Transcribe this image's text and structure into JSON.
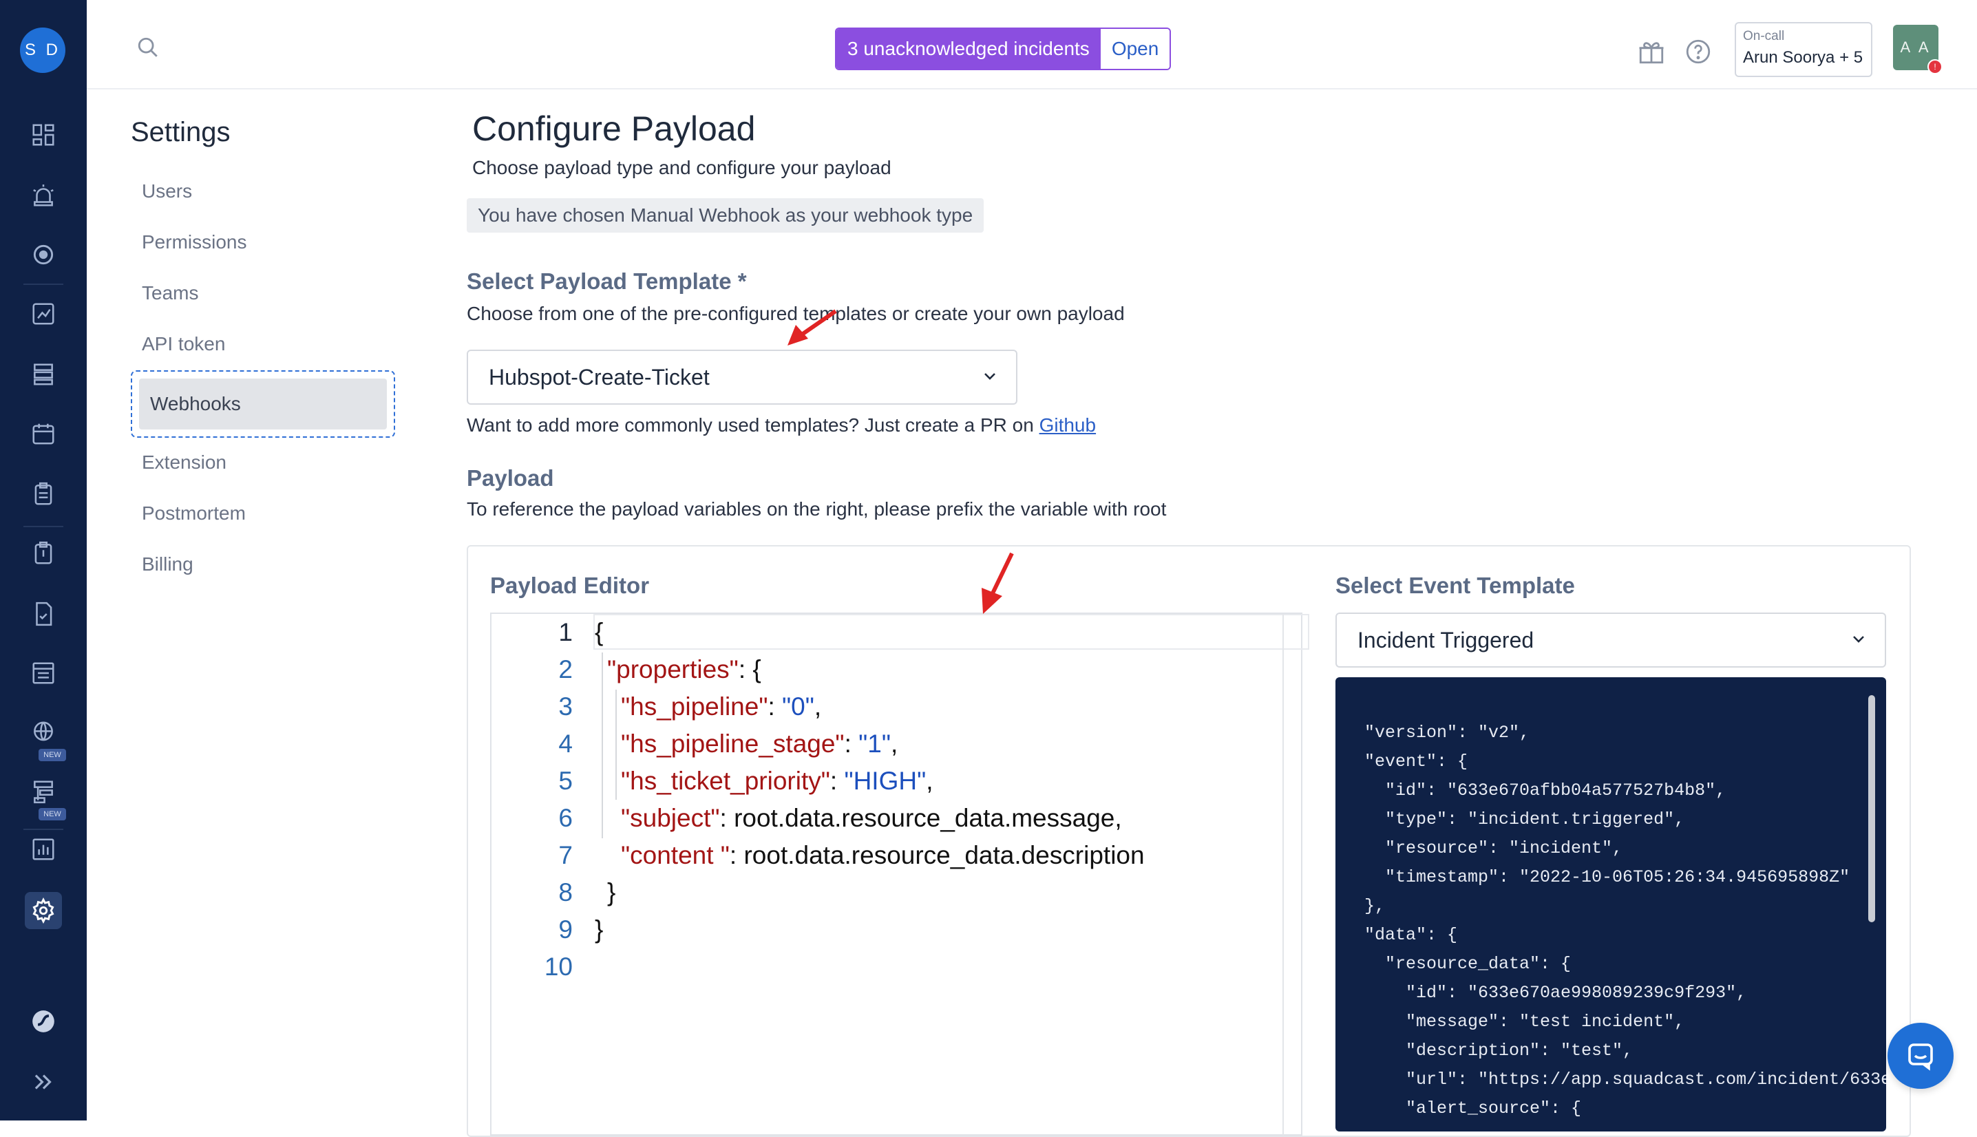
{
  "nav": {
    "avatar_initials": "S D",
    "items": [
      "dashboard-icon",
      "alert-siren-icon",
      "target-icon",
      "analytics-icon",
      "services-icon",
      "calendar-icon",
      "clipboard-icon",
      "runbook-icon",
      "checklist-icon",
      "status-page-icon",
      "globe-new-icon",
      "workflow-new-icon",
      "reports-icon",
      "settings-icon"
    ],
    "new_badge": "NEW"
  },
  "topbar": {
    "incident_text": "3 unacknowledged incidents",
    "incident_action": "Open",
    "oncall_label": "On-call",
    "oncall_value": "Arun Soorya + 5",
    "user_initials": "A A",
    "notification_count": "!"
  },
  "settings": {
    "title": "Settings",
    "items": [
      "Users",
      "Permissions",
      "Teams",
      "API token",
      "Webhooks",
      "Extension",
      "Postmortem",
      "Billing"
    ],
    "active": "Webhooks"
  },
  "main": {
    "title": "Configure Payload",
    "subtitle": "Choose payload type and configure your payload",
    "chip": "You have chosen Manual Webhook as your webhook type",
    "template_heading": "Select Payload Template *",
    "template_desc": "Choose from one of the pre-configured templates or create your own payload",
    "template_value": "Hubspot-Create-Ticket",
    "more_templates_text": "Want to add more commonly used templates? Just create a PR on ",
    "more_templates_link": "Github",
    "payload_heading": "Payload",
    "payload_desc": "To reference the payload variables on the right, please prefix the variable with root",
    "editor_heading": "Payload Editor",
    "event_heading": "Select Event Template",
    "event_value": "Incident Triggered"
  },
  "editor_lines": [
    {
      "n": "1",
      "text": "{"
    },
    {
      "n": "2",
      "key": "\"properties\"",
      "rest": ": {"
    },
    {
      "n": "3",
      "key": "\"hs_pipeline\"",
      "rest": ": ",
      "val": "\"0\"",
      "tail": ","
    },
    {
      "n": "4",
      "key": "\"hs_pipeline_stage\"",
      "rest": ": ",
      "val": "\"1\"",
      "tail": ","
    },
    {
      "n": "5",
      "key": "\"hs_ticket_priority\"",
      "rest": ": ",
      "val": "\"HIGH\"",
      "tail": ","
    },
    {
      "n": "6",
      "key": "\"subject\"",
      "rest": ": root.data.resource_data.message,"
    },
    {
      "n": "7",
      "key": "\"content \"",
      "rest": ": root.data.resource_data.description"
    },
    {
      "n": "8",
      "text": "}"
    },
    {
      "n": "9",
      "text": "}"
    },
    {
      "n": "10",
      "text": ""
    }
  ],
  "event_json": "\"version\": \"v2\",\n\"event\": {\n  \"id\": \"633e670afbb04a577527b4b8\",\n  \"type\": \"incident.triggered\",\n  \"resource\": \"incident\",\n  \"timestamp\": \"2022-10-06T05:26:34.945695898Z\"\n},\n\"data\": {\n  \"resource_data\": {\n    \"id\": \"633e670ae998089239c9f293\",\n    \"message\": \"test incident\",\n    \"description\": \"test\",\n    \"url\": \"https://app.squadcast.com/incident/633e6\n    \"alert_source\": {",
  "colors": {
    "rail": "#0f2146",
    "accent": "#8b4ee0",
    "link": "#2b5fc7",
    "arrow": "#e02424"
  }
}
